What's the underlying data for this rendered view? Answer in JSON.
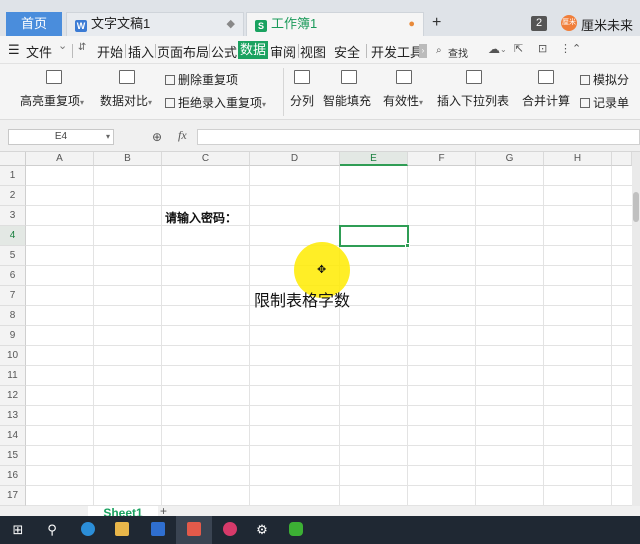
{
  "tabs": {
    "home": "首页",
    "doc_title": "文字文稿1",
    "doc_icon": "W",
    "workbook_title": "工作簿1",
    "workbook_icon": "S",
    "plus": "+",
    "counter": "2",
    "user_name": "厘米未来",
    "user_icon": "厘米"
  },
  "menu": {
    "file": "文件",
    "file_arrow": "⌄",
    "items": [
      "开始",
      "插入",
      "页面布局",
      "公式",
      "数据",
      "审阅",
      "视图",
      "安全",
      "开发工具"
    ],
    "search": "查找",
    "active_index": 4
  },
  "ribbon": {
    "highlight_dup": "高亮重复项",
    "data_compare": "数据对比",
    "delete_dup": "删除重复项",
    "reject_dup": "拒绝录入重复项",
    "split_col": "分列",
    "smart_fill": "智能填充",
    "validity": "有效性",
    "insert_dropdown": "插入下拉列表",
    "consolidate": "合并计算",
    "simulate": "模拟分",
    "record": "记录单"
  },
  "formula_bar": {
    "name_box": "E4",
    "fx": "fx",
    "value": ""
  },
  "grid": {
    "columns": [
      "A",
      "B",
      "C",
      "D",
      "E",
      "F",
      "G",
      "H"
    ],
    "rows": [
      "1",
      "2",
      "3",
      "4",
      "5",
      "6",
      "7",
      "8",
      "9",
      "10",
      "11",
      "12",
      "13",
      "14",
      "15",
      "16",
      "17"
    ],
    "selected_cell": "E4",
    "cell_c3": "请输入密码：",
    "overlay_caption": "限制表格字数"
  },
  "sheets": {
    "active": "Sheet1",
    "add": "+"
  },
  "taskbar": {
    "start": "⊞",
    "search": "⚲"
  },
  "colors": {
    "accent": "#1aa260",
    "selection": "#2f9d55",
    "home_tab": "#4a8ddc",
    "highlight": "#ffeb00"
  }
}
